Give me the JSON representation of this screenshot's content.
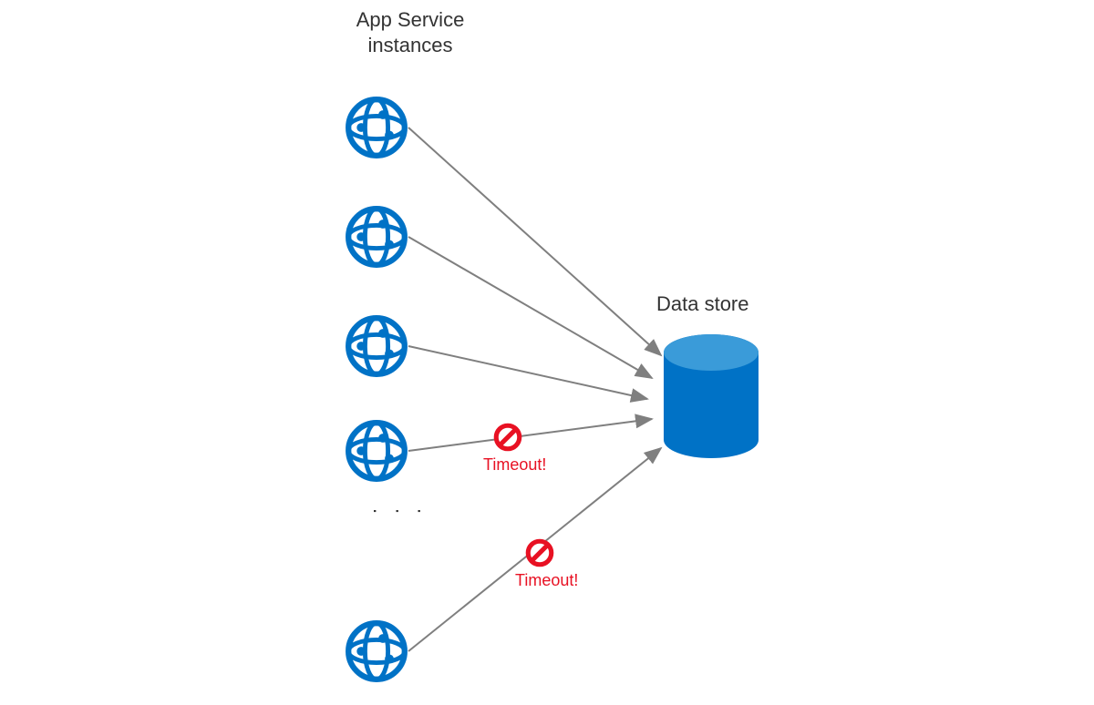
{
  "labels": {
    "app_service_instances": "App Service\ninstances",
    "data_store": "Data store"
  },
  "timeouts": {
    "t1": "Timeout!",
    "t2": "Timeout!"
  },
  "connectors": [
    {
      "from": "instance-1",
      "to": "data-store",
      "status": "ok"
    },
    {
      "from": "instance-2",
      "to": "data-store",
      "status": "ok"
    },
    {
      "from": "instance-3",
      "to": "data-store",
      "status": "ok"
    },
    {
      "from": "instance-4",
      "to": "data-store",
      "status": "timeout"
    },
    {
      "from": "instance-5",
      "to": "data-store",
      "status": "timeout"
    }
  ],
  "colors": {
    "azure_blue": "#0072c6",
    "dark_text": "#333333",
    "arrow": "#7f7f7f",
    "error": "#e81123"
  }
}
